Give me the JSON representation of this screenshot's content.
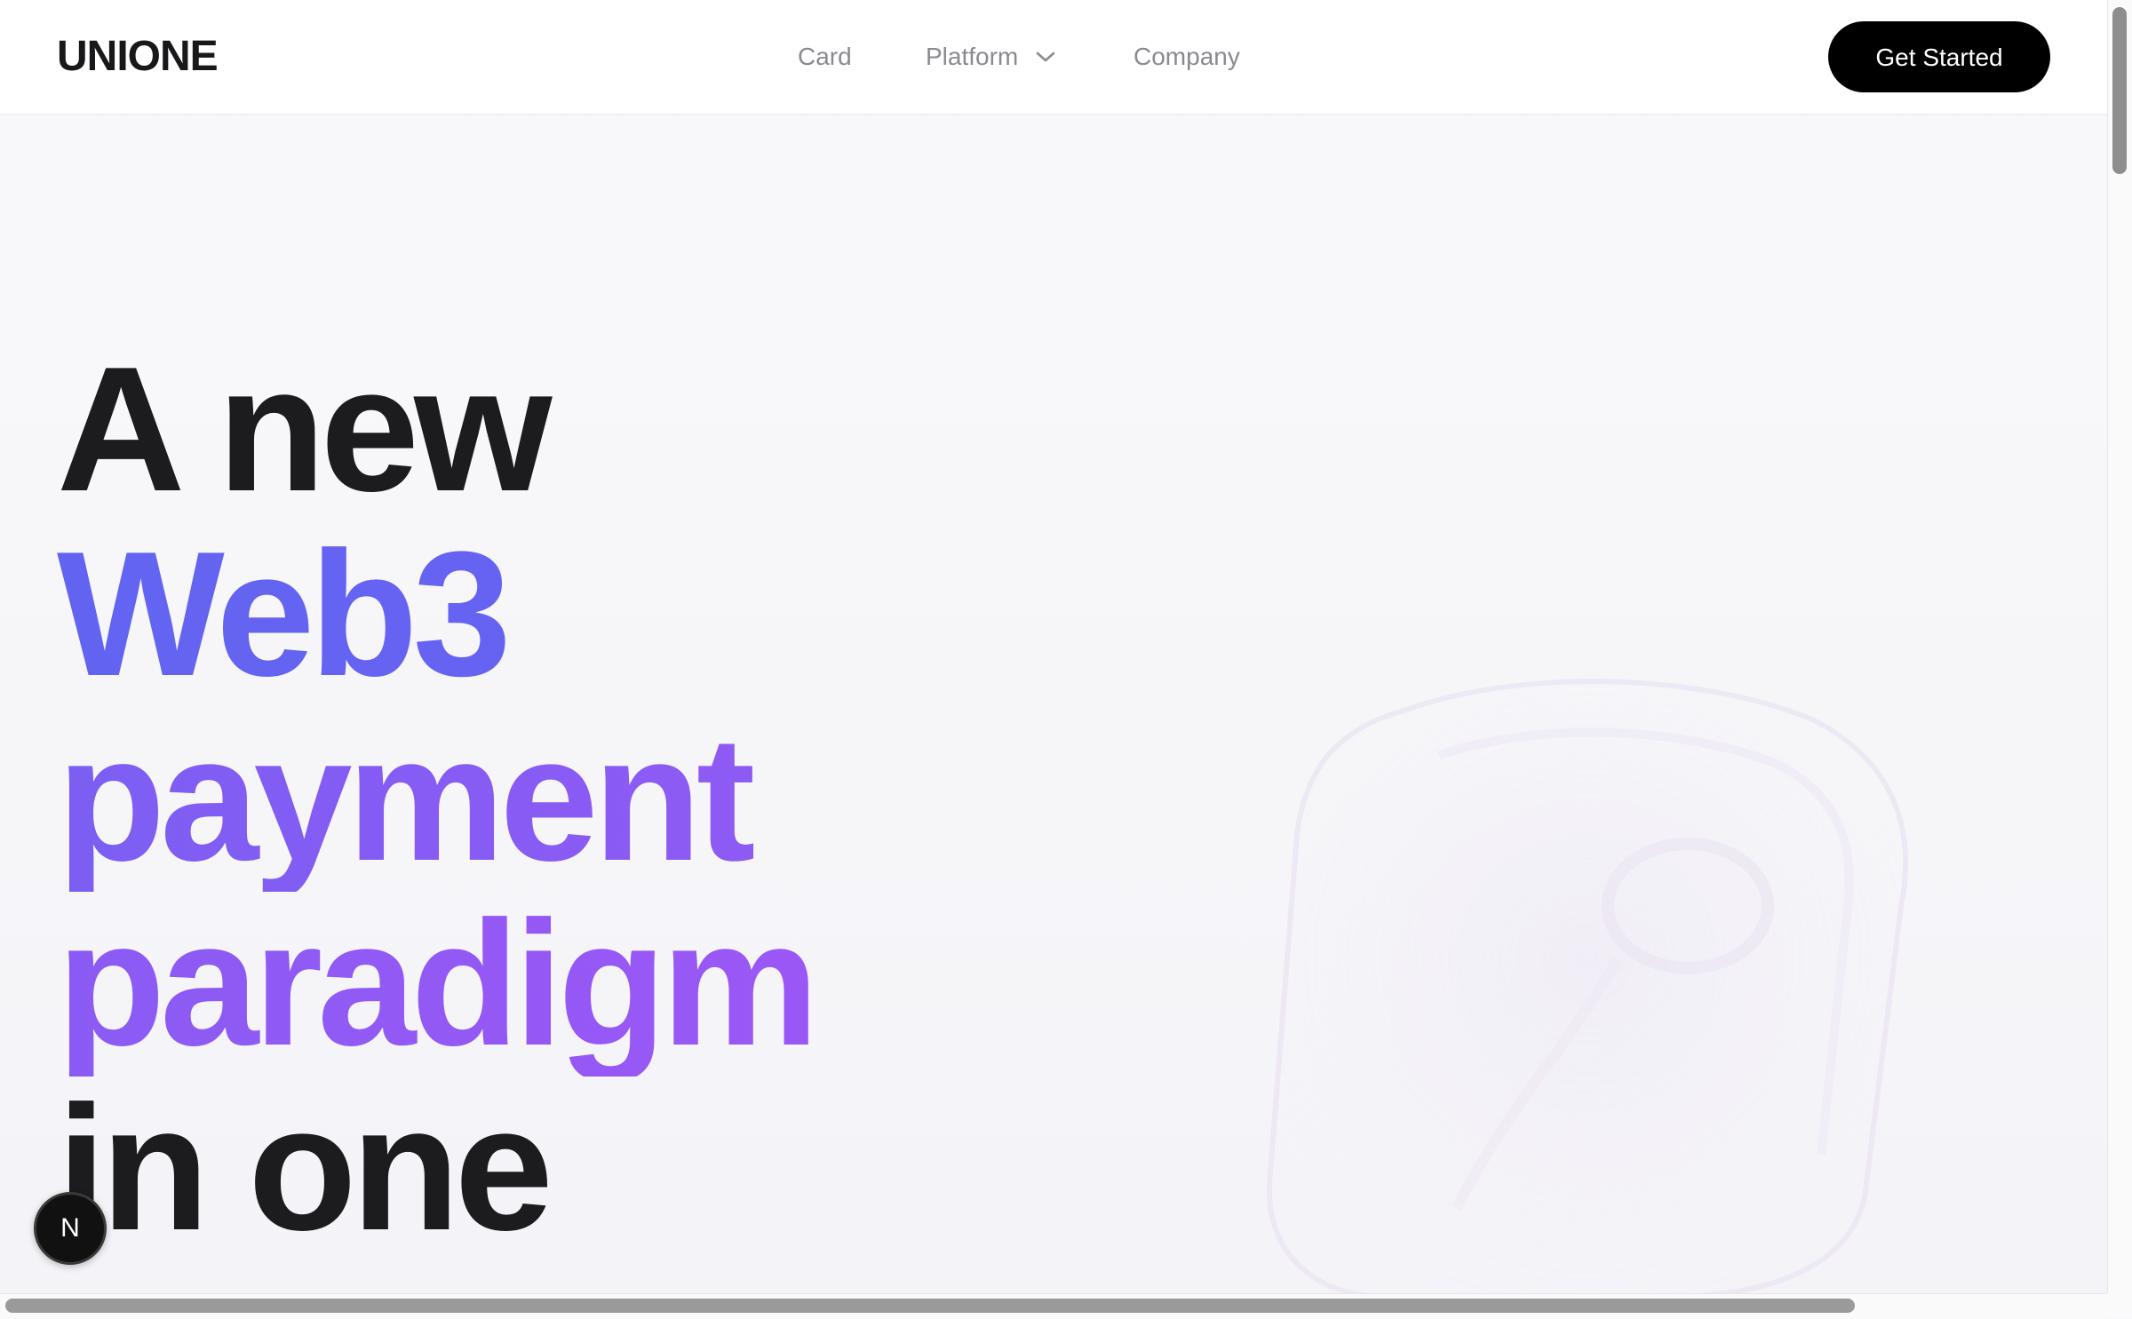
{
  "header": {
    "logo": "UNIONE",
    "nav": {
      "card": "Card",
      "platform": "Platform",
      "company": "Company"
    },
    "cta_label": "Get Started"
  },
  "hero": {
    "line1": "A new",
    "line2": "Web3",
    "line3": "payment",
    "line4": "paradigm",
    "line5": "in one"
  },
  "badge": {
    "label": "N"
  },
  "colors": {
    "accent_start": "#6366f1",
    "accent_end": "#a855f7",
    "text_dark": "#1c1c1f",
    "cta_bg": "#000000"
  },
  "icons": {
    "platform_dropdown": "chevron-down-icon"
  }
}
